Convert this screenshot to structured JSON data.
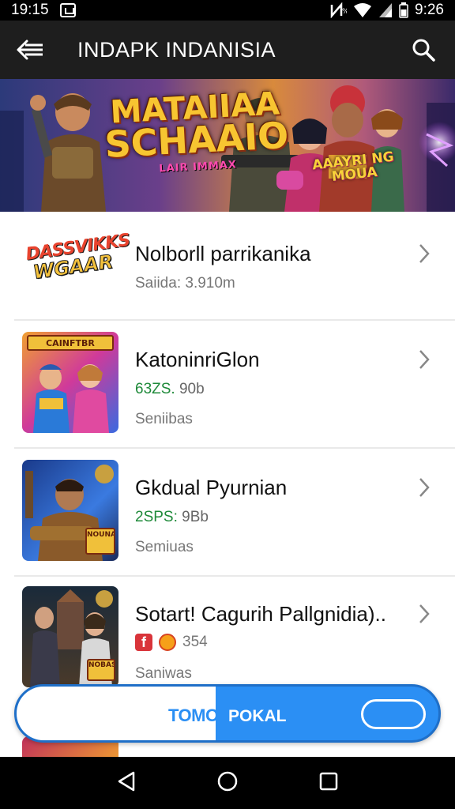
{
  "status_bar": {
    "time_left": "19:15",
    "time_right": "9:26"
  },
  "app_bar": {
    "title": "INDAPK INDANISIA",
    "back_icon": "arrow-left-icon",
    "search_icon": "search-icon"
  },
  "banner": {
    "title_line1": "MATAIIAA",
    "title_line2": "SCHAAIO",
    "subtitle": "LAIR IMMAX",
    "tag_line1": "AAAYRI NG",
    "tag_line2": "MOUA"
  },
  "items": [
    {
      "logo_line1": "DASSVIKKS",
      "logo_line2": "WGAAR",
      "name": "Nolborll parrikanika",
      "meta": "Saiida: 3.910m"
    },
    {
      "thumb_badge": "CAINFTBR",
      "name": "KatoninriGlon",
      "stat_green": "63ZS.",
      "stat_rest": "90b",
      "sub": "Seniibas"
    },
    {
      "thumb_badge": "NOUNA",
      "name": "Gkdual Pyurnian",
      "stat_green": "2SPS:",
      "stat_rest": "9Bb",
      "sub": "Semiuas"
    },
    {
      "thumb_badge": "NOBAS",
      "name": "Sotart! Cagurih Pallgnidia)..",
      "stat": "354",
      "sub": "Saniwas"
    }
  ],
  "bottom_pill": {
    "label_left": "TOMO",
    "label_right": "POKAL"
  },
  "colors": {
    "accent": "#2b8ff4",
    "green_stat": "#1f8a3a",
    "app_bar": "#1e1e1e"
  }
}
